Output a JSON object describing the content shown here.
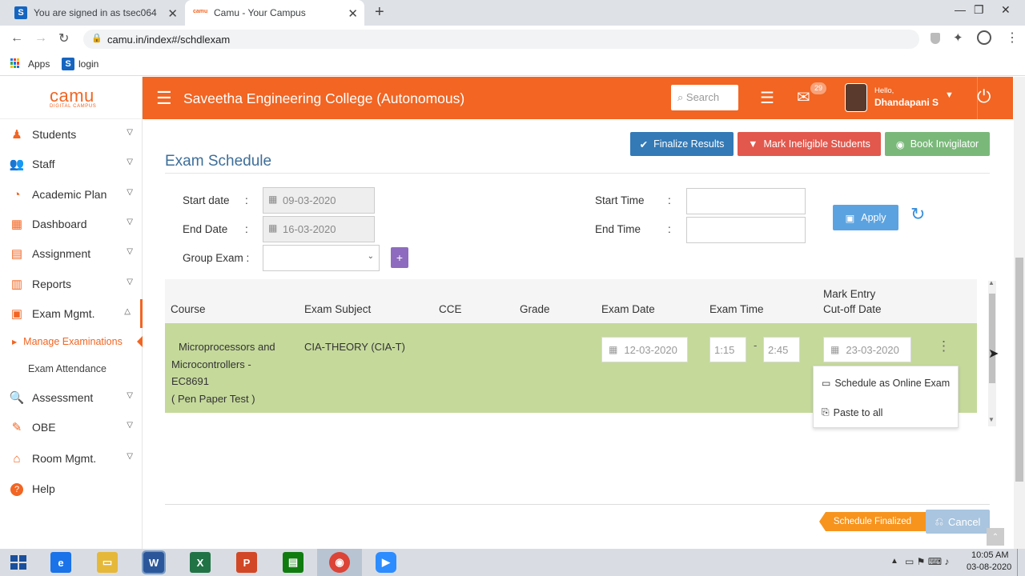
{
  "browser": {
    "tab1_title": "You are signed in as tsec064",
    "tab2_title": "Camu - Your Campus",
    "url": "camu.in/index#/schdlexam",
    "bookmarks": [
      "Apps",
      "login"
    ]
  },
  "brand": {
    "logo": "camu",
    "tagline": "DIGITAL CAMPUS"
  },
  "header": {
    "college": "Saveetha Engineering College (Autonomous)",
    "search_placeholder": "Search",
    "mail_count": "29",
    "greeting": "Hello,",
    "user": "Dhandapani S"
  },
  "sidebar": {
    "items": [
      "Students",
      "Staff",
      "Academic Plan",
      "Dashboard",
      "Assignment",
      "Reports",
      "Exam Mgmt.",
      "Assessment",
      "OBE",
      "Room Mgmt.",
      "Help"
    ],
    "sub_items": [
      "Manage Examinations",
      "Exam Attendance"
    ]
  },
  "actions": {
    "finalize": "Finalize Results",
    "ineligible": "Mark Ineligible Students",
    "invigilator": "Book Invigilator"
  },
  "page_title": "Exam Schedule",
  "filters": {
    "start_date_label": "Start date",
    "start_date": "09-03-2020",
    "end_date_label": "End Date",
    "end_date": "16-03-2020",
    "group_exam_label": "Group Exam :",
    "start_time_label": "Start Time",
    "end_time_label": "End Time",
    "colon": ":",
    "apply": "Apply"
  },
  "table": {
    "headers": [
      "Course",
      "Exam Subject",
      "CCE",
      "Grade",
      "Exam Date",
      "Exam Time",
      "Mark Entry",
      "Cut-off Date"
    ],
    "row": {
      "course_l1": "Microprocessors and",
      "course_l2": "Microcontrollers -",
      "course_l3": "EC8691",
      "course_l4": "( Pen Paper Test )",
      "subject": "CIA-THEORY (CIA-T)",
      "exam_date": "12-03-2020",
      "time_from": "1:15",
      "time_sep": "-",
      "time_to": "2:45",
      "cutoff": "23-03-2020"
    }
  },
  "context_menu": {
    "online": "Schedule as Online Exam",
    "paste": "Paste to all"
  },
  "footer": {
    "status": "Schedule Finalized",
    "cancel": "Cancel"
  },
  "taskbar": {
    "time": "10:05 AM",
    "date": "03-08-2020"
  },
  "colors": {
    "brand": "#f26522",
    "primary": "#337ab7",
    "danger": "#e2584d",
    "success": "#7ab87a"
  }
}
